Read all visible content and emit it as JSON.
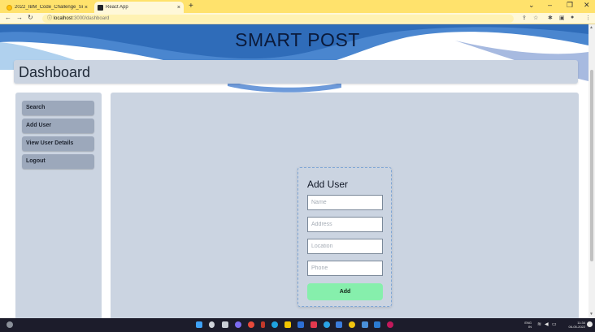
{
  "browser": {
    "tabs": [
      {
        "title": "2022_IBM_Code_Challenge_Smar",
        "close": "×"
      },
      {
        "title": "React App",
        "close": "×"
      }
    ],
    "new_tab": "+",
    "url_host": "localhost",
    "url_path": ":3000/dashboard"
  },
  "app": {
    "brand": "SMART POST",
    "page_title": "Dashboard"
  },
  "sidebar": {
    "items": [
      {
        "label": "Search"
      },
      {
        "label": "Add User"
      },
      {
        "label": "View User Details"
      },
      {
        "label": "Logout"
      }
    ]
  },
  "form": {
    "title": "Add User",
    "fields": [
      {
        "placeholder": "Name",
        "value": ""
      },
      {
        "placeholder": "Address",
        "value": ""
      },
      {
        "placeholder": "Location",
        "value": ""
      },
      {
        "placeholder": "Phone",
        "value": ""
      }
    ],
    "submit_label": "Add"
  },
  "taskbar": {
    "lang_top": "ENG",
    "lang_bottom": "IN",
    "time": "11:34",
    "date": "06-05-2022"
  },
  "colors": {
    "accent_wave": "#3b7ac9",
    "panel": "#cbd4e1",
    "nav_item": "#9ca8bb",
    "add_button": "#86efac"
  }
}
